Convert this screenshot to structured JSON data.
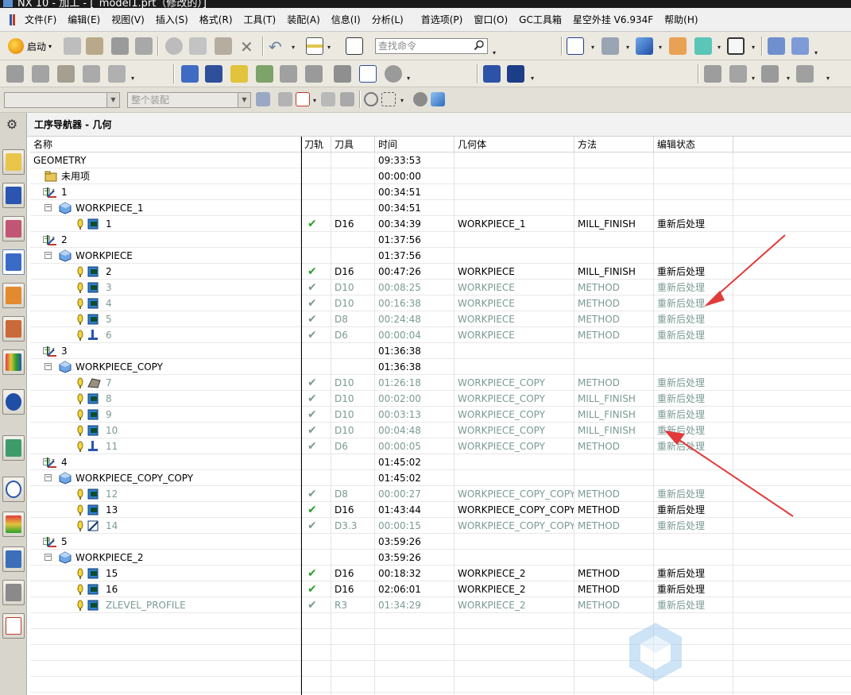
{
  "window": {
    "title": "NX 10 - 加工 - [_model1.prt（修改的）]"
  },
  "menu": [
    "文件(F)",
    "编辑(E)",
    "视图(V)",
    "插入(S)",
    "格式(R)",
    "工具(T)",
    "装配(A)",
    "信息(I)",
    "分析(L)",
    "首选项(P)",
    "窗口(O)",
    "GC工具箱",
    "星空外挂 V6.934F",
    "帮助(H)"
  ],
  "toolbar": {
    "start_label": "启动",
    "search_placeholder": "查找命令",
    "selection_filter": "",
    "assembly_scope": "整个装配"
  },
  "navigator": {
    "title": "工序导航器 - 几何",
    "columns": [
      "名称",
      "刀轨",
      "刀具",
      "时间",
      "几何体",
      "方法",
      "编辑状态"
    ],
    "rows": [
      {
        "level": 0,
        "icon": "none",
        "name": "GEOMETRY",
        "time": "09:33:53"
      },
      {
        "level": 1,
        "icon": "folder",
        "name": "未用项",
        "time": "00:00:00"
      },
      {
        "level": 1,
        "icon": "mcs",
        "exp": "−",
        "name": "1",
        "time": "00:34:51"
      },
      {
        "level": 2,
        "icon": "workpiece",
        "exp": "−",
        "name": "WORKPIECE_1",
        "time": "00:34:51"
      },
      {
        "level": 3,
        "icon": "mill-op",
        "name": "1",
        "path": "✔",
        "tool": "D16",
        "time": "00:34:39",
        "geom": "WORKPIECE_1",
        "method": "MILL_FINISH",
        "status": "重新后处理"
      },
      {
        "level": 1,
        "icon": "mcs",
        "exp": "−",
        "name": "2",
        "time": "01:37:56"
      },
      {
        "level": 2,
        "icon": "workpiece",
        "exp": "−",
        "name": "WORKPIECE",
        "time": "01:37:56"
      },
      {
        "level": 3,
        "icon": "mill-op",
        "name": "2",
        "path": "✔",
        "tool": "D16",
        "time": "00:47:26",
        "geom": "WORKPIECE",
        "method": "MILL_FINISH",
        "status": "重新后处理"
      },
      {
        "level": 3,
        "icon": "mill-op",
        "dim": true,
        "name": "3",
        "path": "✔",
        "tool": "D10",
        "time": "00:08:25",
        "geom": "WORKPIECE",
        "method": "METHOD",
        "status": "重新后处理"
      },
      {
        "level": 3,
        "icon": "mill-op",
        "dim": true,
        "name": "4",
        "path": "✔",
        "tool": "D10",
        "time": "00:16:38",
        "geom": "WORKPIECE",
        "method": "METHOD",
        "status": "重新后处理"
      },
      {
        "level": 3,
        "icon": "mill-op",
        "dim": true,
        "name": "5",
        "path": "✔",
        "tool": "D8",
        "time": "00:24:48",
        "geom": "WORKPIECE",
        "method": "METHOD",
        "status": "重新后处理"
      },
      {
        "level": 3,
        "icon": "drill-op",
        "dim": true,
        "name": "6",
        "path": "✔",
        "tool": "D6",
        "time": "00:00:04",
        "geom": "WORKPIECE",
        "method": "METHOD",
        "status": "重新后处理"
      },
      {
        "level": 1,
        "icon": "mcs",
        "exp": "−",
        "name": "3",
        "time": "01:36:38"
      },
      {
        "level": 2,
        "icon": "workpiece",
        "exp": "−",
        "name": "WORKPIECE_COPY",
        "time": "01:36:38"
      },
      {
        "level": 3,
        "icon": "cavity-op",
        "dim": true,
        "name": "7",
        "path": "✔",
        "tool": "D10",
        "time": "01:26:18",
        "geom": "WORKPIECE_COPY",
        "method": "METHOD",
        "status": "重新后处理"
      },
      {
        "level": 3,
        "icon": "mill-op",
        "dim": true,
        "name": "8",
        "path": "✔",
        "tool": "D10",
        "time": "00:02:00",
        "geom": "WORKPIECE_COPY",
        "method": "MILL_FINISH",
        "status": "重新后处理"
      },
      {
        "level": 3,
        "icon": "mill-op",
        "dim": true,
        "name": "9",
        "path": "✔",
        "tool": "D10",
        "time": "00:03:13",
        "geom": "WORKPIECE_COPY",
        "method": "MILL_FINISH",
        "status": "重新后处理"
      },
      {
        "level": 3,
        "icon": "mill-op",
        "dim": true,
        "name": "10",
        "path": "✔",
        "tool": "D10",
        "time": "00:04:48",
        "geom": "WORKPIECE_COPY",
        "method": "MILL_FINISH",
        "status": "重新后处理"
      },
      {
        "level": 3,
        "icon": "drill-op",
        "dim": true,
        "name": "11",
        "path": "✔",
        "tool": "D6",
        "time": "00:00:05",
        "geom": "WORKPIECE_COPY",
        "method": "METHOD",
        "status": "重新后处理"
      },
      {
        "level": 1,
        "icon": "mcs",
        "exp": "−",
        "name": "4",
        "time": "01:45:02"
      },
      {
        "level": 2,
        "icon": "workpiece",
        "exp": "−",
        "name": "WORKPIECE_COPY_COPY",
        "time": "01:45:02"
      },
      {
        "level": 3,
        "icon": "mill-op",
        "dim": true,
        "name": "12",
        "path": "✔",
        "tool": "D8",
        "time": "00:00:27",
        "geom": "WORKPIECE_COPY_COPY",
        "method": "METHOD",
        "status": "重新后处理"
      },
      {
        "level": 3,
        "icon": "mill-op",
        "name": "13",
        "path": "✔",
        "tool": "D16",
        "time": "01:43:44",
        "geom": "WORKPIECE_COPY_COPY",
        "method": "METHOD",
        "status": "重新后处理"
      },
      {
        "level": 3,
        "icon": "engrave-op",
        "dim": true,
        "name": "14",
        "path": "✔",
        "tool": "D3.3",
        "time": "00:00:15",
        "geom": "WORKPIECE_COPY_COPY",
        "method": "METHOD",
        "status": "重新后处理"
      },
      {
        "level": 1,
        "icon": "mcs",
        "exp": "−",
        "name": "5",
        "time": "03:59:26"
      },
      {
        "level": 2,
        "icon": "workpiece",
        "exp": "−",
        "name": "WORKPIECE_2",
        "time": "03:59:26"
      },
      {
        "level": 3,
        "icon": "mill-op",
        "name": "15",
        "path": "✔",
        "tool": "D16",
        "time": "00:18:32",
        "geom": "WORKPIECE_2",
        "method": "METHOD",
        "status": "重新后处理"
      },
      {
        "level": 3,
        "icon": "mill-op",
        "name": "16",
        "path": "✔",
        "tool": "D16",
        "time": "02:06:01",
        "geom": "WORKPIECE_2",
        "method": "METHOD",
        "status": "重新后处理"
      },
      {
        "level": 3,
        "icon": "mill-op",
        "dim": true,
        "name": "ZLEVEL_PROFILE",
        "path": "✔",
        "tool": "R3",
        "time": "01:34:29",
        "geom": "WORKPIECE_2",
        "method": "METHOD",
        "status": "重新后处理"
      }
    ]
  },
  "colors": {
    "accent": "#2a5aa0",
    "check": "#2aa02a",
    "dimText": "#7a9a94",
    "arrow": "#e23a3a"
  }
}
